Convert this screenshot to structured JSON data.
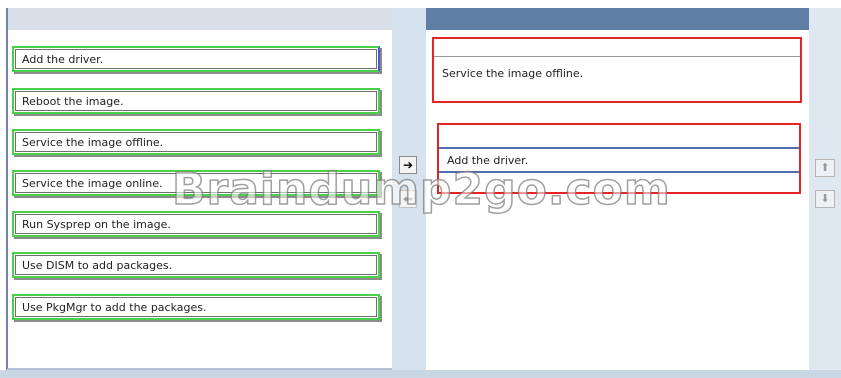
{
  "source_items": [
    {
      "label": "Add the driver."
    },
    {
      "label": "Reboot the image."
    },
    {
      "label": "Service the image offline."
    },
    {
      "label": "Service the image online."
    },
    {
      "label": "Run Sysprep on the image."
    },
    {
      "label": "Use DISM to add packages."
    },
    {
      "label": "Use PkgMgr to add the packages."
    }
  ],
  "answer_area": {
    "slots": [
      {
        "label": "Service the image offline."
      },
      {
        "label": "Add the driver."
      }
    ]
  },
  "controls": {
    "move_right_icon": "right-arrow-icon",
    "move_left_icon": "left-arrow-icon",
    "move_up_icon": "up-arrow-icon",
    "move_down_icon": "down-arrow-icon"
  },
  "watermark": "Braindump2go.com",
  "colors": {
    "item_border": "#4ad14a",
    "slot_border": "#e52424",
    "header_accent": "#5f7ea6"
  }
}
